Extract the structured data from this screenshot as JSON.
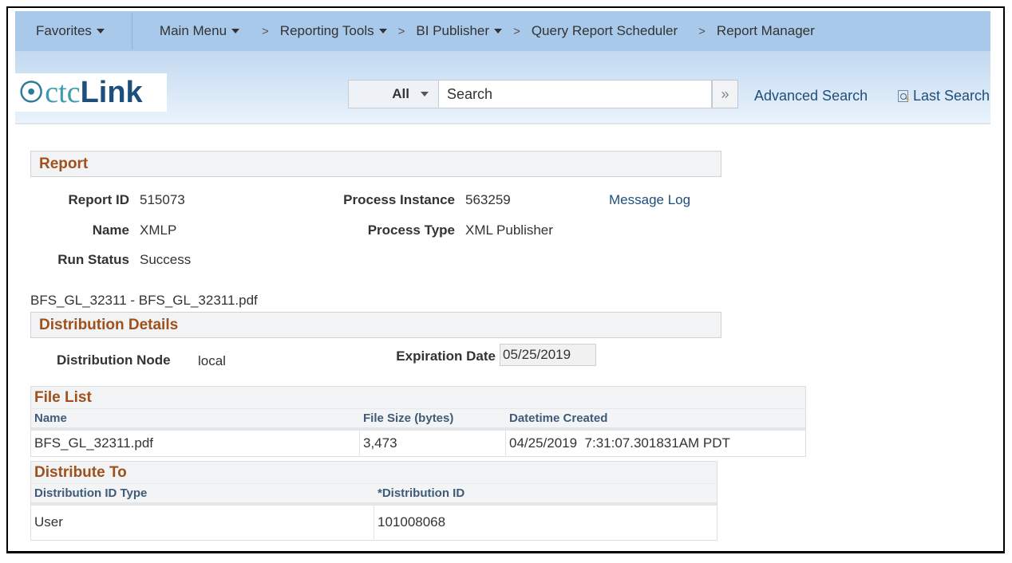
{
  "nav": {
    "favorites": "Favorites",
    "main_menu": "Main Menu",
    "breadcrumbs": [
      {
        "label": "Reporting Tools",
        "dropdown": true
      },
      {
        "label": "BI Publisher",
        "dropdown": true
      },
      {
        "label": "Query Report Scheduler",
        "dropdown": false
      },
      {
        "label": "Report Manager",
        "dropdown": false
      }
    ],
    "separator": ">"
  },
  "header": {
    "logo_icon": "ctclink-swirl-icon",
    "logo_ctc": "ctc",
    "logo_link": "Link",
    "search_scope": "All",
    "search_value": "Search",
    "go_symbol": "»",
    "advanced_search": "Advanced Search",
    "last_search": "Last Search"
  },
  "report": {
    "section_title": "Report",
    "report_id_label": "Report ID",
    "report_id": "515073",
    "process_instance_label": "Process Instance",
    "process_instance": "563259",
    "message_log": "Message Log",
    "name_label": "Name",
    "name": "XMLP",
    "process_type_label": "Process Type",
    "process_type": "XML Publisher",
    "run_status_label": "Run Status",
    "run_status": "Success",
    "file_caption": "BFS_GL_32311 - BFS_GL_32311.pdf"
  },
  "distribution": {
    "section_title": "Distribution Details",
    "node_label": "Distribution Node",
    "node": "local",
    "expiration_label": "Expiration Date",
    "expiration": "05/25/2019"
  },
  "file_list": {
    "title": "File List",
    "columns": [
      "Name",
      "File Size (bytes)",
      "Datetime Created"
    ],
    "rows": [
      {
        "name": "BFS_GL_32311.pdf",
        "size": "3,473",
        "created": "04/25/2019  7:31:07.301831AM PDT"
      }
    ]
  },
  "distribute_to": {
    "title": "Distribute To",
    "columns": [
      "Distribution ID Type",
      "*Distribution ID"
    ],
    "rows": [
      {
        "type": "User",
        "id": "101008068"
      }
    ]
  }
}
